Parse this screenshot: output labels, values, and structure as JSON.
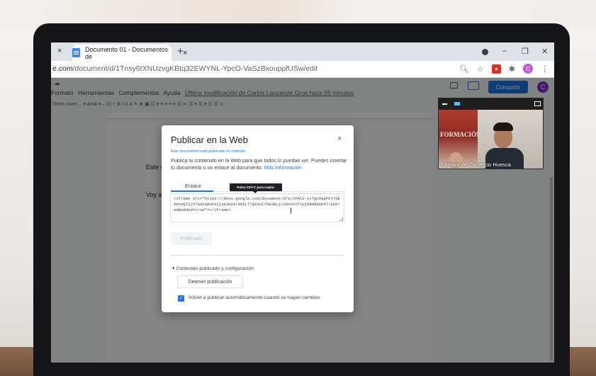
{
  "browser": {
    "tab_title": "Documento 01 - Documentos de",
    "tab_close": "×",
    "new_tab": "+",
    "url_domain": "e.com",
    "url_path": "/document/d/1Tnsy6tXNUzvgKBtq32EWYNL-YpcO-VaSzBxouppfUSw/edit",
    "avatar_letter": "C",
    "win_minimize": "–",
    "win_maximize": "❐",
    "win_close": "✕"
  },
  "docs": {
    "menu": [
      "Formato",
      "Herramientas",
      "Complementos",
      "Ayuda"
    ],
    "last_modified": "Última modificación de Carlos Lanzarote Gros hace 55 minutos",
    "share_label": "Compartir",
    "user_letter": "C",
    "toolbar_text": "Texto norm…  ▾   Arial   ▾   –  11  +   B  I  U  A  ✎   ⊕  ▣  ⊡ ▾   ≡  ≡  ≡  ≡   ☰  ⇤  ☰ ▾  ☰ ▾  ☰  ☰   ⨯",
    "page_text_1": "Este e",
    "page_text_2": "Voy a a"
  },
  "dialog": {
    "title": "Publicar en la Web",
    "close": "×",
    "published_note": "Este documento está publicado en Internet.",
    "description": "Publica tu contenido en la Web para que todos lo puedan ver. Puedes insertar tu documento o un enlace al documento.",
    "more_info": "Más información",
    "tab_link": "Enlace",
    "tooltip": "Pulsa Ctrl+C para copiar.",
    "embed_code": "<iframe src=\"https://docs.google.com/document/d/e/2PACX-1vTgn0qpPPJTOE99noQ72jh7a4ZqAUXs2jymJmj9l00SLT7gk1oCYhWJBcjy28notnfxUjbBH9p6Dbl/pub?embedded=true\"></iframe>",
    "published_button": "Publicado",
    "config_toggle": "Contenido publicado y configuración",
    "stop_button": "Detener publicación",
    "auto_republish": "Volver a publicar automáticamente cuando se hagan cambios"
  },
  "video": {
    "participant_name": "Cámara de Comercio Huesca",
    "banner_text": "FORMACIÓN"
  }
}
